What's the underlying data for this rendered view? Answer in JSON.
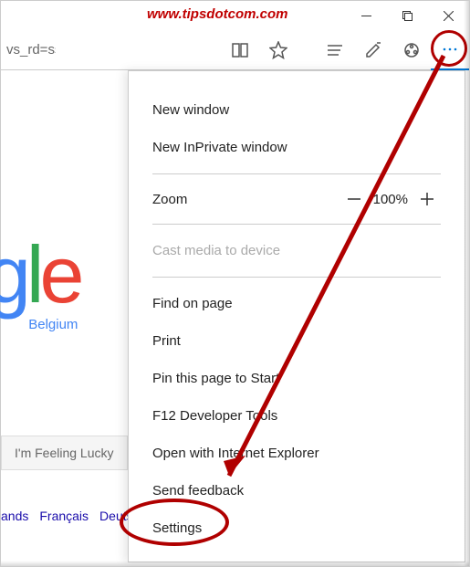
{
  "watermark": "www.tipsdotcom.com",
  "url_fragment": "vs_rd=ssl",
  "google": {
    "country": "Belgium"
  },
  "lucky_button": "I'm Feeling Lucky",
  "languages": [
    "ands",
    "Français",
    "Deutsch"
  ],
  "zoom": {
    "label": "Zoom",
    "value": "100%"
  },
  "menu": {
    "new_window": "New window",
    "new_inprivate": "New InPrivate window",
    "cast": "Cast media to device",
    "find": "Find on page",
    "print": "Print",
    "pin": "Pin this page to Start",
    "devtools": "F12 Developer Tools",
    "open_ie": "Open with Internet Explorer",
    "feedback": "Send feedback",
    "settings": "Settings"
  }
}
